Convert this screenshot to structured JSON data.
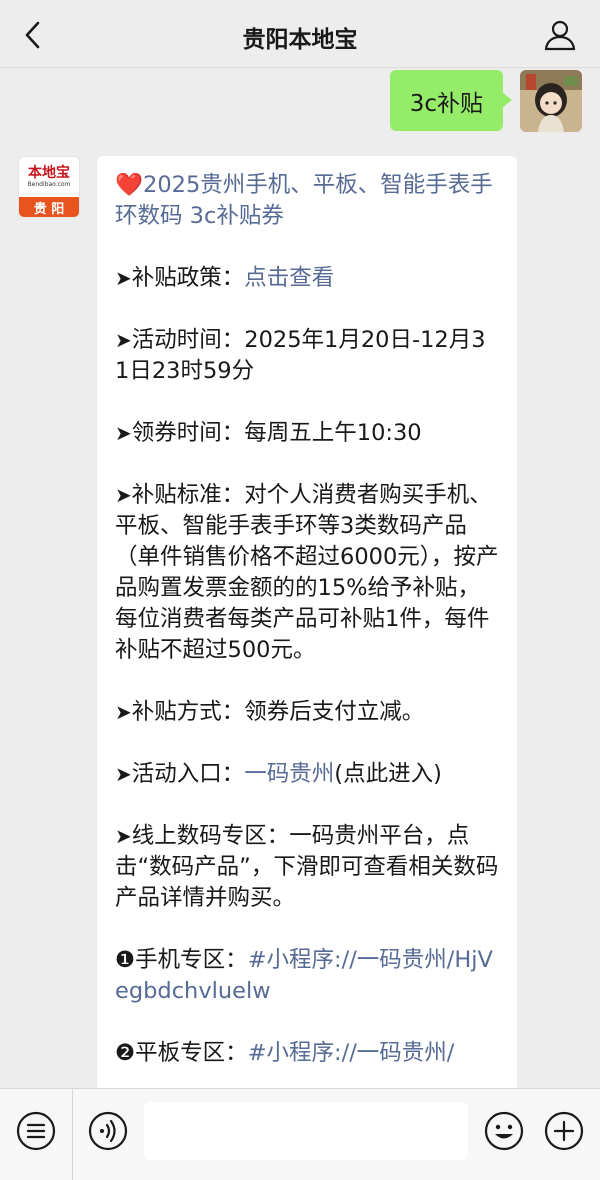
{
  "header": {
    "title": "贵阳本地宝",
    "back_icon": "chevron-left-icon",
    "profile_icon": "person-icon"
  },
  "user_message": {
    "text": "3c补贴",
    "bubble_color": "#95ec69"
  },
  "bot_account": {
    "logo_name": "本地宝",
    "logo_url": "Bendibao.com",
    "logo_city": "贵 阳"
  },
  "bot_message": {
    "title_emoji": "❤️",
    "title": "2025贵州手机、平板、智能手表手环数码 3c补贴券",
    "policy_label": "补贴政策：",
    "policy_link": "点击查看",
    "time_label": "活动时间：",
    "time_value": "2025年1月20日-12月31日23时59分",
    "claim_label": "领券时间：",
    "claim_value": "每周五上午10:30",
    "standard_label": "补贴标准：",
    "standard_value": "对个人消费者购买手机、平板、智能手表手环等3类数码产品（单件销售价格不超过6000元），按产品购置发票金额的的15%给予补贴，每位消费者每类产品可补贴1件，每件补贴不超过500元。",
    "method_label": "补贴方式：",
    "method_value": "领券后支付立减。",
    "entry_label": "活动入口：",
    "entry_link": "一码贵州",
    "entry_suffix": "(点此进入)",
    "online_label": "线上数码专区：",
    "online_value": "一码贵州平台，点击“数码产品”，下滑即可查看相关数码产品详情并购买。",
    "phone_bullet": "❶",
    "phone_label": "手机专区：",
    "phone_link": "#小程序://一码贵州/HjVegbdchvluelw",
    "tablet_bullet": "❷",
    "tablet_label": "平板专区：",
    "tablet_link": "#小程序://一码贵州/",
    "link_color": "#576b95",
    "arrow": "➤"
  },
  "input_bar": {
    "voice_icon": "voice-icon",
    "emoji_icon": "emoji-icon",
    "plus_icon": "plus-icon",
    "menu_icon": "menu-icon"
  }
}
